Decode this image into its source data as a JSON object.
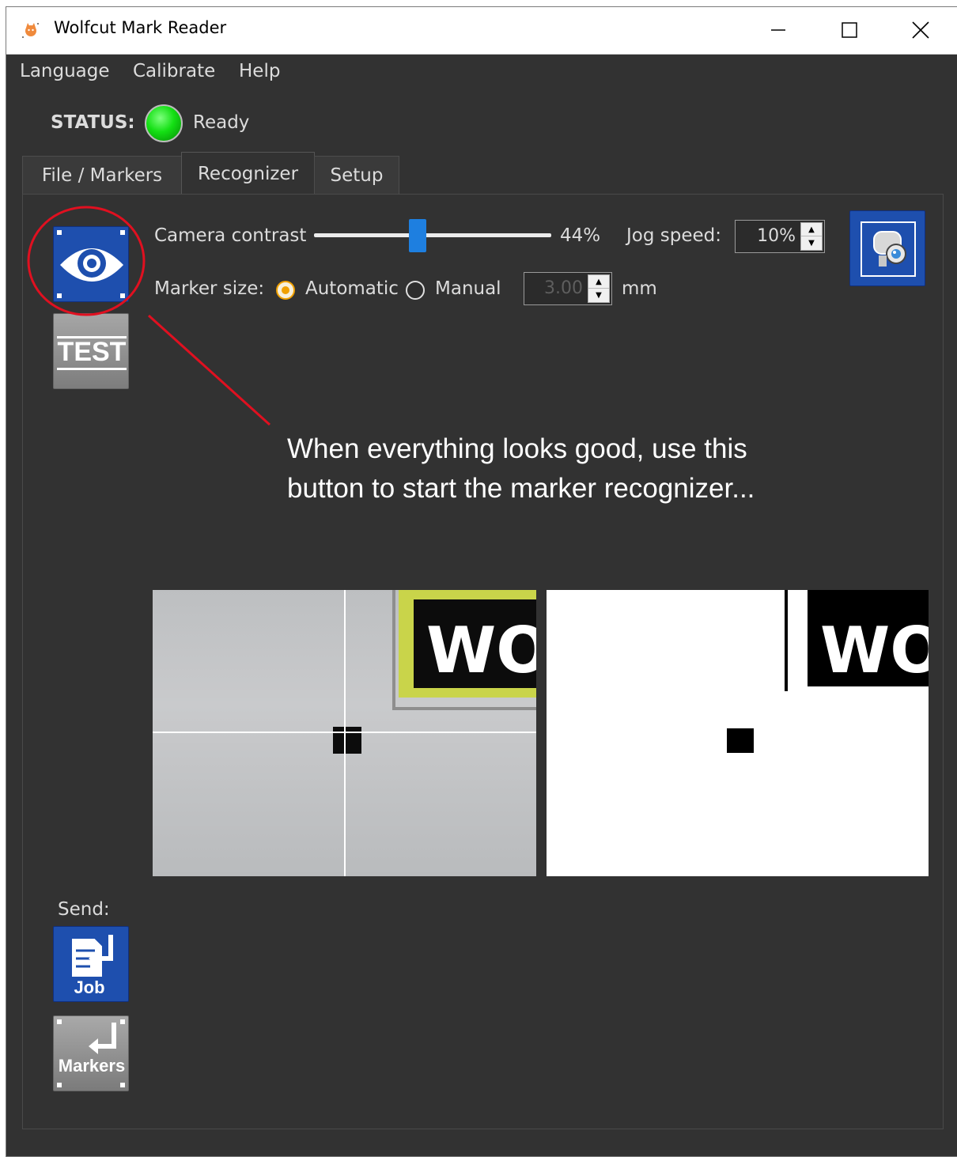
{
  "window": {
    "title": "Wolfcut Mark Reader",
    "controls": [
      "minimize-icon",
      "maximize-icon",
      "close-icon"
    ]
  },
  "menu": {
    "items": [
      {
        "label": "Language"
      },
      {
        "label": "Calibrate"
      },
      {
        "label": "Help"
      }
    ]
  },
  "status": {
    "label": "STATUS:",
    "text": "Ready",
    "led_color": "#14e014"
  },
  "tabs": [
    {
      "label": "File / Markers",
      "active": false
    },
    {
      "label": "Recognizer",
      "active": true
    },
    {
      "label": "Setup",
      "active": false
    }
  ],
  "recognizer": {
    "camera_contrast_label": "Camera contrast",
    "camera_contrast_value": "44%",
    "camera_contrast_fraction": 0.44,
    "jog_speed_label": "Jog speed:",
    "jog_speed_value": "10%",
    "marker_size_label": "Marker size:",
    "marker_size_options": [
      {
        "label": "Automatic",
        "checked": true
      },
      {
        "label": "Manual",
        "checked": false
      }
    ],
    "marker_size_value": "3.00",
    "marker_size_unit": "mm",
    "test_button_label": "TEST",
    "camera_views": {
      "left_view_text": "WO",
      "right_view_text": "WO"
    }
  },
  "annotation": {
    "line1": "When everything looks good, use this",
    "line2": "button to start the marker recognizer..."
  },
  "send": {
    "label": "Send:",
    "job_button_label": "Job",
    "markers_button_label": "Markers"
  },
  "colors": {
    "panel_bg": "#323232",
    "accent_blue": "#1e4fae",
    "slider_blue": "#1e7fe0",
    "annotation_red": "#e01020",
    "radio_orange": "#f0a000"
  }
}
